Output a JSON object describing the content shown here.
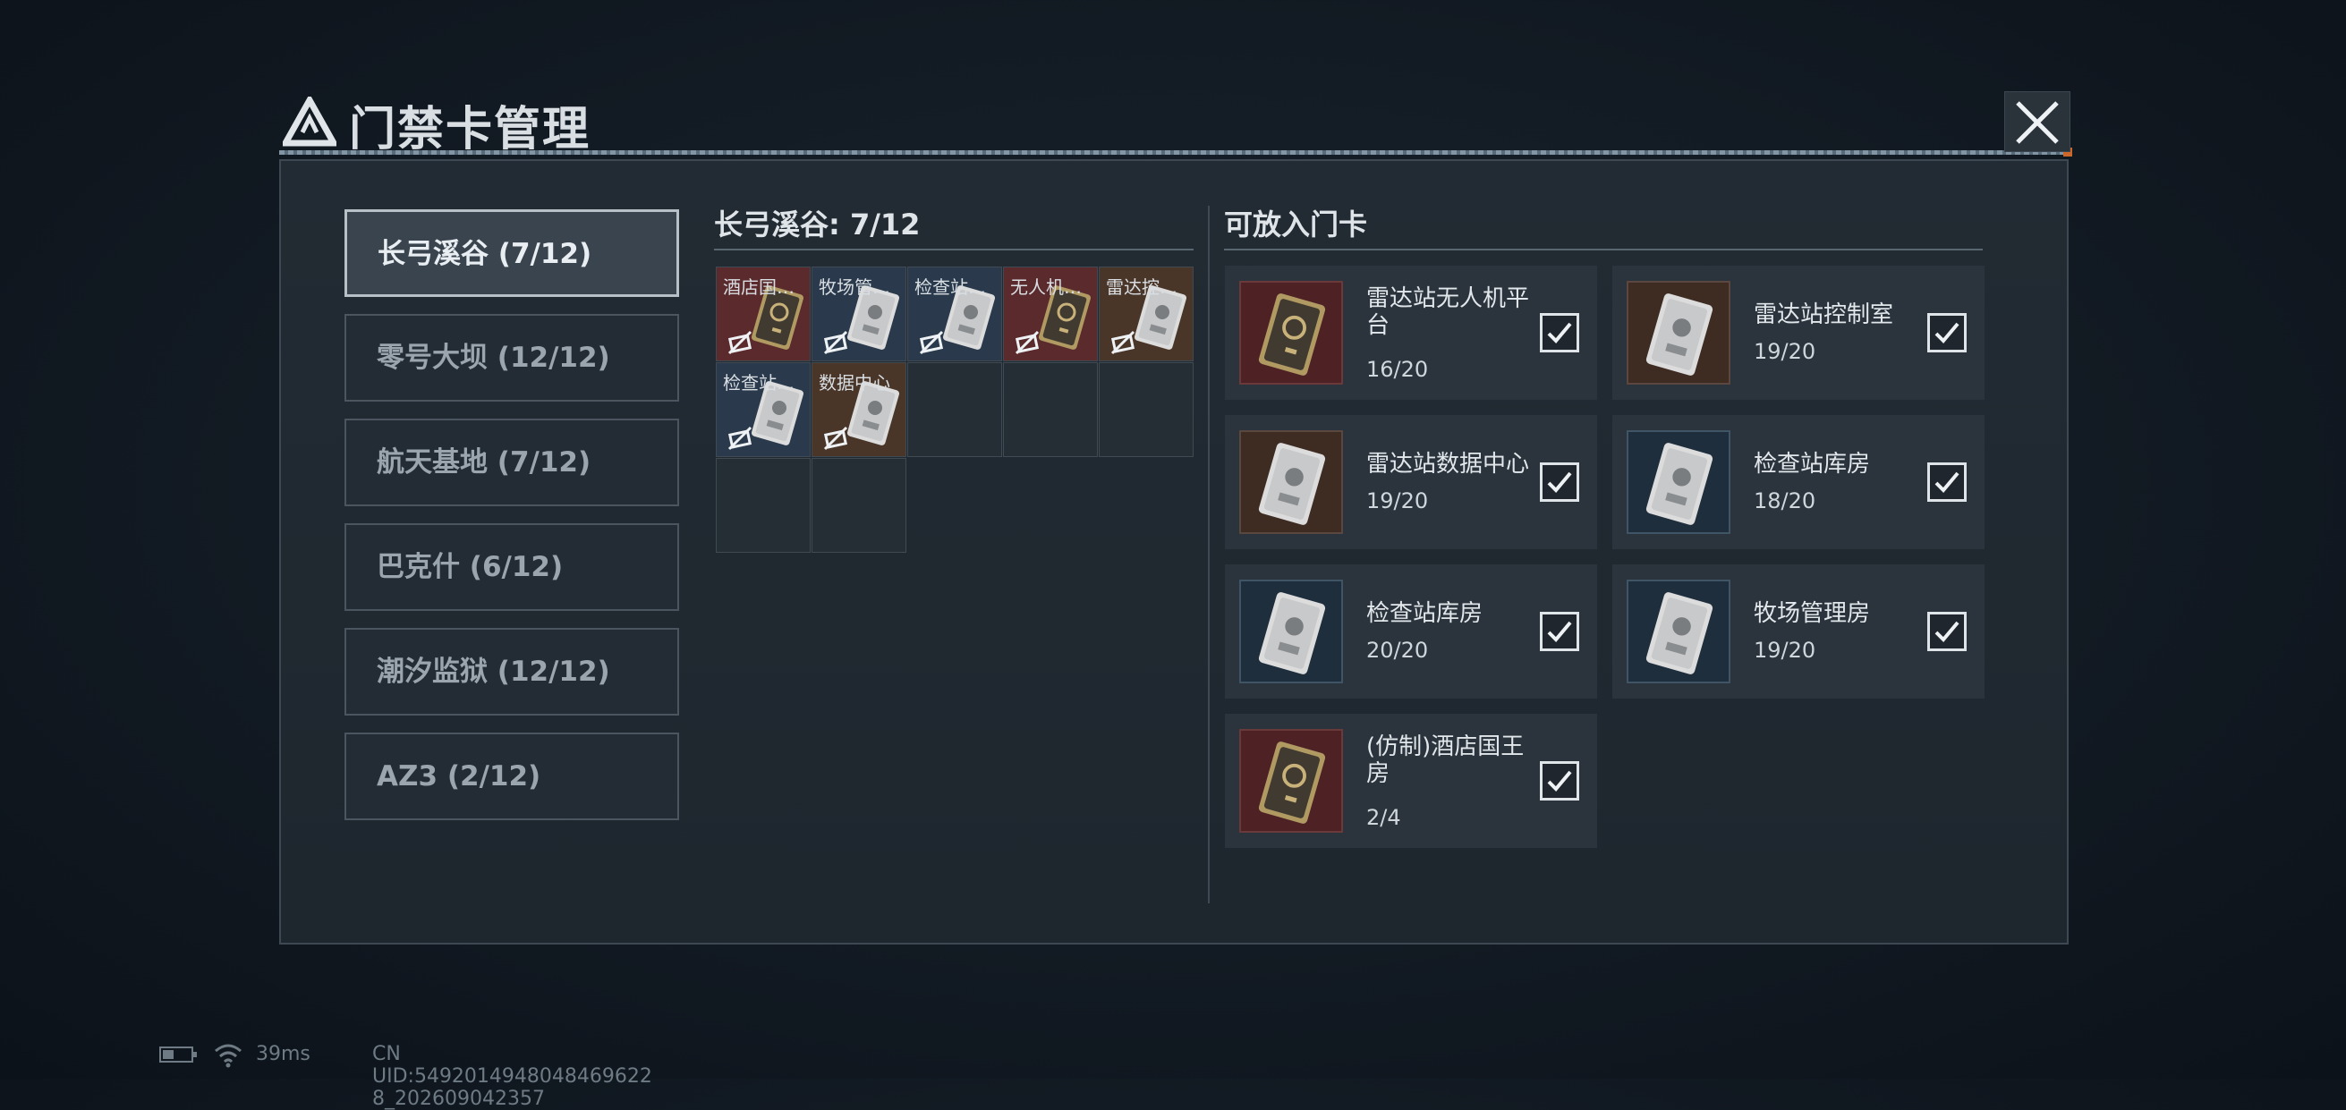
{
  "title": "门禁卡管理",
  "maps": [
    {
      "label": "长弓溪谷 (7/12)",
      "active": true
    },
    {
      "label": "零号大坝 (12/12)",
      "active": false
    },
    {
      "label": "航天基地 (7/12)",
      "active": false
    },
    {
      "label": "巴克什 (6/12)",
      "active": false
    },
    {
      "label": "潮汐监狱 (12/12)",
      "active": false
    },
    {
      "label": "AZ3 (2/12)",
      "active": false
    }
  ],
  "slots_section": {
    "title": "长弓溪谷: 7/12",
    "slots": [
      {
        "label": "酒店国…",
        "color": "#5a2a2c",
        "card": "gold"
      },
      {
        "label": "牧场管…",
        "color": "#2a3a4c",
        "card": "silver"
      },
      {
        "label": "检查站…",
        "color": "#2a3a4c",
        "card": "silver"
      },
      {
        "label": "无人机…",
        "color": "#5a2a2c",
        "card": "gold"
      },
      {
        "label": "雷达控…",
        "color": "#4a3628",
        "card": "silver"
      },
      {
        "label": "检查站…",
        "color": "#2a3a4c",
        "card": "silver"
      },
      {
        "label": "数据中心",
        "color": "#4a3628",
        "card": "silver"
      }
    ]
  },
  "available_section": {
    "title": "可放入门卡",
    "cards": [
      {
        "name": "雷达站无人机平台",
        "count": "16/20",
        "color": "#4e2225",
        "card": "gold",
        "checked": true
      },
      {
        "name": "雷达站控制室",
        "count": "19/20",
        "color": "#3e2c22",
        "card": "silver",
        "checked": true
      },
      {
        "name": "雷达站数据中心",
        "count": "19/20",
        "color": "#3e2c22",
        "card": "silver",
        "checked": true
      },
      {
        "name": "检查站库房",
        "count": "18/20",
        "color": "#1e2e3d",
        "card": "silver",
        "checked": true
      },
      {
        "name": "检查站库房",
        "count": "20/20",
        "color": "#1e2e3d",
        "card": "silver",
        "checked": true
      },
      {
        "name": "牧场管理房",
        "count": "19/20",
        "color": "#1e2e3d",
        "card": "silver",
        "checked": true
      },
      {
        "name": "(仿制)酒店国王房",
        "count": "2/4",
        "color": "#4e2225",
        "card": "gold",
        "checked": true
      }
    ]
  },
  "status": {
    "ping": "39ms",
    "uid": "CN UID:5492014948048469622​8_202609042357"
  },
  "icons": {
    "close": "close-icon",
    "logo": "delta-logo-icon",
    "check": "checkmark-icon",
    "slot": "slot-marker-icon",
    "wifi": "wifi-icon",
    "battery": "battery-icon"
  }
}
